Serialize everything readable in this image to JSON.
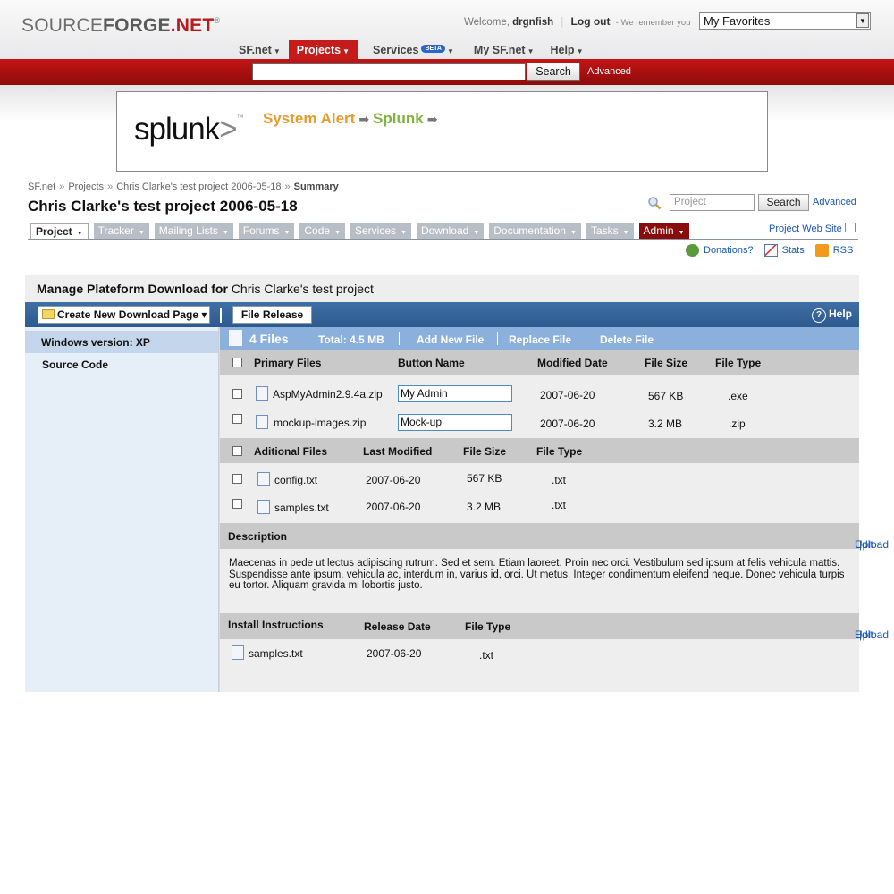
{
  "header": {
    "logo": {
      "part1": "SOURCE",
      "part2": "FORGE",
      "part3": ".NET",
      "reg": "®"
    },
    "welcome_prefix": "Welcome,",
    "username": "drgnfish",
    "logout": "Log out",
    "remember": "- We remember you",
    "favorites": "My Favorites",
    "nav": [
      {
        "label": "SF.net",
        "active": false
      },
      {
        "label": "Projects",
        "active": true
      },
      {
        "label": "Services",
        "badge": "BETA",
        "active": false
      },
      {
        "label": "My SF.net",
        "active": false
      },
      {
        "label": "Help",
        "active": false
      }
    ],
    "search_button": "Search",
    "advanced": "Advanced"
  },
  "ad": {
    "logo": "splunk",
    "logo_gt": ">",
    "tm": "™",
    "word1": "System Alert",
    "word2": "Splunk",
    "arrow": "➡"
  },
  "breadcrumb": [
    "SF.net",
    "Projects",
    "Chris Clarke's test project 2006-05-18",
    "Summary"
  ],
  "breadcrumb_sep": "»",
  "page_title": "Chris Clarke's test project 2006-05-18",
  "project_search": {
    "placeholder": "Project",
    "button": "Search",
    "advanced": "Advanced"
  },
  "tabs": [
    {
      "label": "Project",
      "state": "current"
    },
    {
      "label": "Tracker",
      "state": "normal"
    },
    {
      "label": "Mailing Lists",
      "state": "normal"
    },
    {
      "label": "Forums",
      "state": "normal"
    },
    {
      "label": "Code",
      "state": "normal"
    },
    {
      "label": "Services",
      "state": "normal"
    },
    {
      "label": "Download",
      "state": "normal"
    },
    {
      "label": "Documentation",
      "state": "normal"
    },
    {
      "label": "Tasks",
      "state": "normal"
    },
    {
      "label": "Admin",
      "state": "admin"
    }
  ],
  "project_web_site": "Project Web Site",
  "links": {
    "donations": "Donations?",
    "stats": "Stats",
    "rss": "RSS"
  },
  "panel": {
    "title_bold": "Manage Plateform Download for",
    "title_project": "Chris Clarke's test project",
    "create_button": "Create New Download Page ▾",
    "file_release": "File Release",
    "help": "Help",
    "help_icon": "?"
  },
  "left_nav": [
    {
      "label": "Windows   version: XP",
      "selected": true
    },
    {
      "label": "Source Code",
      "selected": false
    }
  ],
  "files_bar": {
    "count": "4 Files",
    "total": "Total: 4.5 MB",
    "add": "Add New File",
    "replace": "Replace File",
    "delete": "Delete File"
  },
  "primary": {
    "headers": [
      "Primary Files",
      "Button Name",
      "Modified Date",
      "File Size",
      "File Type"
    ],
    "rows": [
      {
        "name": "AspMyAdmin2.9.4a.zip",
        "button": "My Admin",
        "date": "2007-06-20",
        "size": "567 KB",
        "type": ".exe"
      },
      {
        "name": "mockup-images.zip",
        "button": "Mock-up",
        "date": "2007-06-20",
        "size": "3.2 MB",
        "type": ".zip"
      }
    ]
  },
  "additional": {
    "headers": [
      "Aditional Files",
      "Last Modified",
      "File Size",
      "File Type"
    ],
    "rows": [
      {
        "name": "config.txt",
        "date": "2007-06-20",
        "size": "567 KB",
        "type": ".txt"
      },
      {
        "name": "samples.txt",
        "date": "2007-06-20",
        "size": "3.2 MB",
        "type": ".txt"
      }
    ]
  },
  "description": {
    "header": "Description",
    "edit": "Edit",
    "upload": "Upload",
    "separator": "|",
    "text": "Maecenas in pede ut lectus adipiscing rutrum. Sed et sem. Etiam laoreet. Proin nec orci. Vestibulum sed ipsum at felis vehicula mattis. Suspendisse ante ipsum, vehicula ac, interdum in, varius id, orci. Ut metus. Integer condimentum eleifend neque. Donec vehicula turpis eu tortor. Aliquam gravida mi lobortis justo."
  },
  "install": {
    "headers": [
      "Install Instructions",
      "Release Date",
      "File Type"
    ],
    "edit": "Edit",
    "upload": "Upload",
    "rows": [
      {
        "name": "samples.txt",
        "date": "2007-06-20",
        "type": ".txt"
      }
    ]
  }
}
